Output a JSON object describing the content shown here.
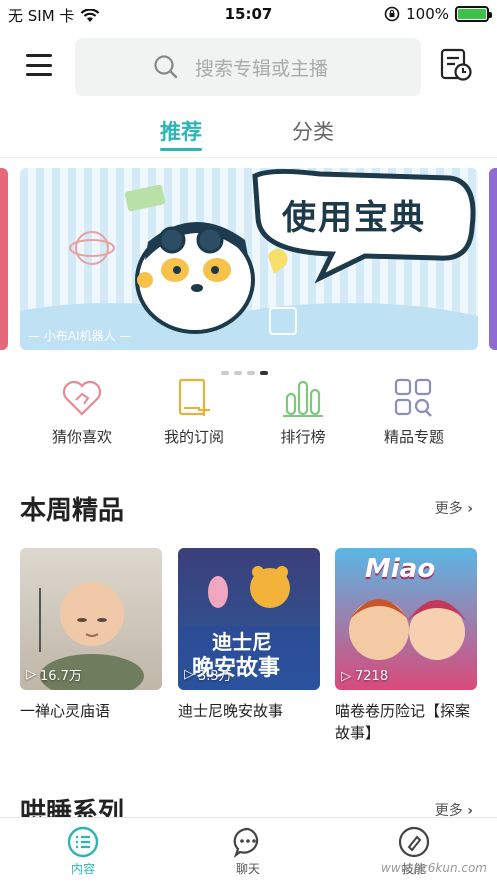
{
  "status": {
    "carrier": "无 SIM 卡",
    "time": "15:07",
    "battery": "100%"
  },
  "search": {
    "placeholder": "搜索专辑或主播"
  },
  "tabs": [
    {
      "label": "推荐"
    },
    {
      "label": "分类"
    }
  ],
  "banner": {
    "title": "使用宝典",
    "caption": "— 小布AI机器人 —",
    "active_dot": 4,
    "dot_count": 4
  },
  "quick": [
    {
      "label": "猜你喜欢",
      "icon": "heart-hand-icon"
    },
    {
      "label": "我的订阅",
      "icon": "book-add-icon"
    },
    {
      "label": "排行榜",
      "icon": "bar-chart-icon"
    },
    {
      "label": "精品专题",
      "icon": "grid-search-icon"
    }
  ],
  "weekly": {
    "title": "本周精品",
    "more": "更多",
    "items": [
      {
        "title": "一禅心灵庙语",
        "plays": "16.7万"
      },
      {
        "title": "迪士尼晚安故事",
        "plays": "3.3万",
        "cover_text": "迪士尼",
        "cover_text2": "晚安故事"
      },
      {
        "title": "喵卷卷历险记【探案故事】",
        "plays": "7218",
        "cover_text": "Miao"
      }
    ]
  },
  "sleep": {
    "title": "哄睡系列",
    "more": "更多"
  },
  "tabbar": [
    {
      "label": "内容"
    },
    {
      "label": "聊天"
    },
    {
      "label": "技能"
    }
  ],
  "watermark": "www.pc6kun.com",
  "colors": {
    "accent": "#2bb5b5"
  }
}
